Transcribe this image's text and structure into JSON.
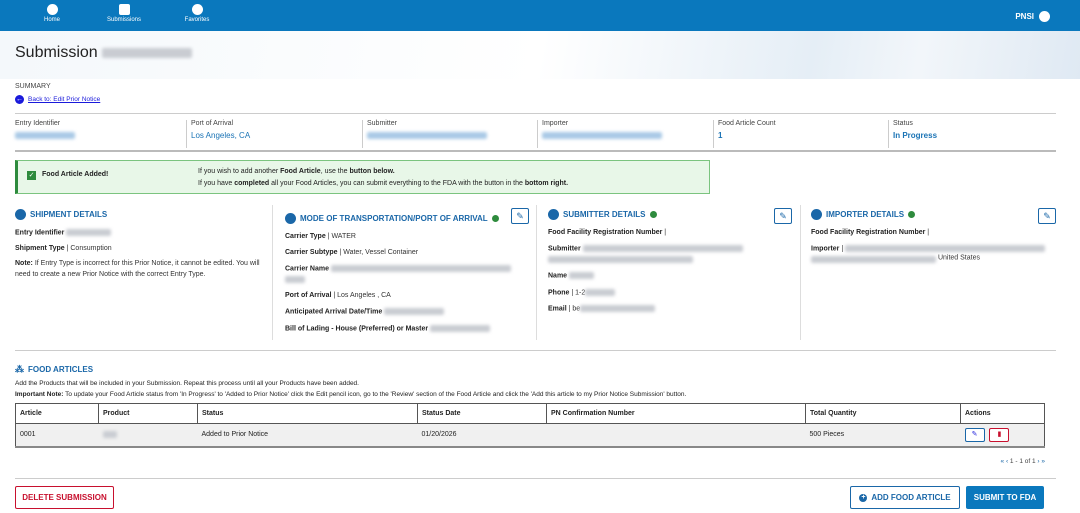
{
  "nav": {
    "items": [
      {
        "label": "Home"
      },
      {
        "label": "Submissions"
      },
      {
        "label": "Favorites"
      }
    ],
    "user": "PNSI"
  },
  "page": {
    "title": "Submission",
    "section": "SUMMARY",
    "back_link": "Back to: Edit Prior Notice"
  },
  "summary": [
    {
      "label": "Entry Identifier"
    },
    {
      "label": "Port of Arrival",
      "value": "Los Angeles, CA"
    },
    {
      "label": "Submitter"
    },
    {
      "label": "Importer"
    },
    {
      "label": "Food Article Count",
      "value": "1"
    },
    {
      "label": "Status",
      "value": "In Progress"
    }
  ],
  "alert": {
    "title": "Food Article Added!",
    "line1_a": "If you wish to add another ",
    "line1_b": "Food Article",
    "line1_c": ", use the ",
    "line1_d": "button below.",
    "line2_a": "If you have ",
    "line2_b": "completed",
    "line2_c": " all your Food Articles, you can submit everything to the FDA with the button in the ",
    "line2_d": "bottom right."
  },
  "shipment": {
    "title": "SHIPMENT DETAILS",
    "entry_label": "Entry Identifier",
    "type_label": "Shipment Type",
    "type_value": "Consumption",
    "note_label": "Note:",
    "note": " If Entry Type is incorrect for this Prior Notice, it cannot be edited. You will need to create a new Prior Notice with the correct Entry Type."
  },
  "transport": {
    "title": "MODE OF TRANSPORTATION/PORT OF ARRIVAL",
    "carrier_type_label": "Carrier Type",
    "carrier_type": "WATER",
    "carrier_subtype_label": "Carrier Subtype",
    "carrier_subtype": "Water, Vessel Container",
    "carrier_name_label": "Carrier Name",
    "port_label": "Port of Arrival",
    "port": "Los Angeles , CA",
    "arrival_label": "Anticipated Arrival Date/Time",
    "bol_label": "Bill of Lading - House (Preferred) or Master"
  },
  "submitter": {
    "title": "SUBMITTER DETAILS",
    "ffrn_label": "Food Facility Registration Number",
    "submitter_label": "Submitter",
    "name_label": "Name",
    "phone_label": "Phone",
    "phone": "1-2",
    "email_label": "Email",
    "email": "be"
  },
  "importer": {
    "title": "IMPORTER DETAILS",
    "ffrn_label": "Food Facility Registration Number",
    "importer_label": "Importer",
    "country": "United States"
  },
  "food_articles": {
    "title": "FOOD ARTICLES",
    "desc": "Add the Products that will be included in your Submission. Repeat this process until all your Products have been added.",
    "note_label": "Important Note:",
    "note": " To update your Food Article status from 'In Progress' to 'Added to Prior Notice' click the Edit pencil icon, go to the 'Review' section of the Food Article and click the 'Add this article to my Prior Notice Submission' button.",
    "columns": [
      "Article",
      "Product",
      "Status",
      "Status Date",
      "PN Confirmation Number",
      "Total Quantity",
      "Actions"
    ],
    "rows": [
      {
        "article": "0001",
        "status": "Added to Prior Notice",
        "status_date": "01/20/2026",
        "pn": "",
        "quantity": "500 Pieces"
      }
    ],
    "pager": "1 - 1 of 1"
  },
  "actions": {
    "delete": "DELETE SUBMISSION",
    "add": "ADD FOOD ARTICLE",
    "submit": "SUBMIT TO FDA"
  },
  "colors": {
    "primary": "#0a78bd",
    "success": "#2e8b3d",
    "danger": "#c8102e"
  }
}
